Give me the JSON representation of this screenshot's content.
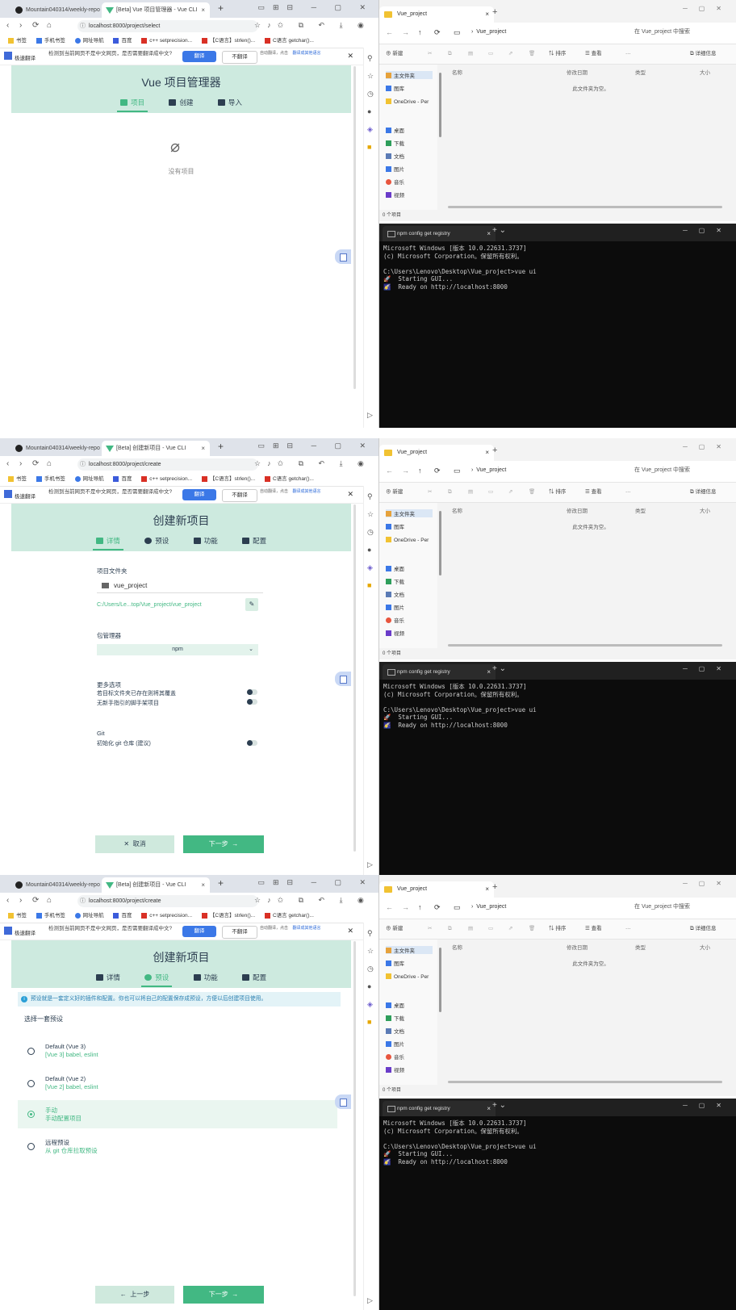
{
  "panels": [
    {
      "browser": {
        "tabs": [
          "Mountain040314/weekly-repo",
          "[Beta] Vue 项目管理器 - Vue CLI"
        ],
        "url": "localhost:8000/project/select",
        "page_title": "Vue 项目管理器",
        "nav_tabs": [
          "项目",
          "创建",
          "导入"
        ],
        "empty_text": "没有项目"
      }
    },
    {
      "browser": {
        "tabs": [
          "Mountain040314/weekly-repo",
          "[Beta] 创建新项目 - Vue CLI"
        ],
        "url": "localhost:8000/project/create",
        "page_title": "创建新项目",
        "nav_tabs": [
          "详情",
          "预设",
          "功能",
          "配置"
        ],
        "folder_label": "项目文件夹",
        "folder_value": "vue_project",
        "folder_path": "C:/Users/Le...top/Vue_project/vue_project",
        "pm_label": "包管理器",
        "pm_value": "npm",
        "more_label": "更多选项",
        "opt1": "若目标文件夹已存在则将其覆盖",
        "opt2": "无新手指引的脚手架项目",
        "git_label": "Git",
        "git_opt": "初始化 git 仓库 (建议)",
        "btn_cancel": "取消",
        "btn_next": "下一步"
      }
    },
    {
      "browser": {
        "tabs": [
          "Mountain040314/weekly-repo",
          "[Beta] 创建新项目 - Vue CLI"
        ],
        "url": "localhost:8000/project/create",
        "page_title": "创建新项目",
        "nav_tabs": [
          "详情",
          "预设",
          "功能",
          "配置"
        ],
        "info": "预设就是一套定义好的插件和配置。你也可以将自己的配置保存成预设，方便以后创建项目使用。",
        "choose_label": "选择一套预设",
        "presets": [
          {
            "name": "Default (Vue 3)",
            "desc": "[Vue 3] babel, eslint"
          },
          {
            "name": "Default (Vue 2)",
            "desc": "[Vue 2] babel, eslint"
          },
          {
            "name": "手动",
            "desc": "手动配置项目"
          },
          {
            "name": "远程预设",
            "desc": "从 git 仓库拉取预设"
          }
        ],
        "btn_prev": "上一步",
        "btn_next": "下一步"
      }
    }
  ],
  "common": {
    "bookmarks": [
      "书签",
      "手机书签",
      "网址导航",
      "百度",
      "c++ setprecision...",
      "【C语言】strlen()...",
      "C语言 getchar()..."
    ],
    "translate": {
      "logo_text": "极速翻译",
      "question": "检测到当前网页不是中文网页，是否需要翻译成中文?",
      "btn_translate": "翻译",
      "btn_no": "不翻译",
      "hint": "自动翻译，点击",
      "link": "翻译成其他语言"
    },
    "explorer": {
      "tab": "Vue_project",
      "path": "Vue_project",
      "search": "在 Vue_project 中搜索",
      "new": "新建",
      "sort": "排序",
      "view": "查看",
      "details": "详细信息",
      "nav": [
        "主文件夹",
        "图库",
        "OneDrive - Per",
        "桌面",
        "下载",
        "文档",
        "图片",
        "音乐",
        "视频"
      ],
      "cols": [
        "名称",
        "修改日期",
        "类型",
        "大小"
      ],
      "empty": "此文件夹为空。",
      "status": "0 个项目"
    },
    "terminal": {
      "tab": "npm config get registry",
      "lines": [
        "Microsoft Windows [版本 10.0.22631.3737]",
        "(c) Microsoft Corporation。保留所有权利。",
        "",
        "C:\\Users\\Lenovo\\Desktop\\Vue_project>vue ui",
        "🚀  Starting GUI...",
        "🌠  Ready on http://localhost:8000"
      ]
    }
  },
  "colors": {
    "accent": "#42b883",
    "header_bg": "#cdeadf",
    "text": "#2c3e50",
    "terminal_bg": "#0c0c0c"
  }
}
